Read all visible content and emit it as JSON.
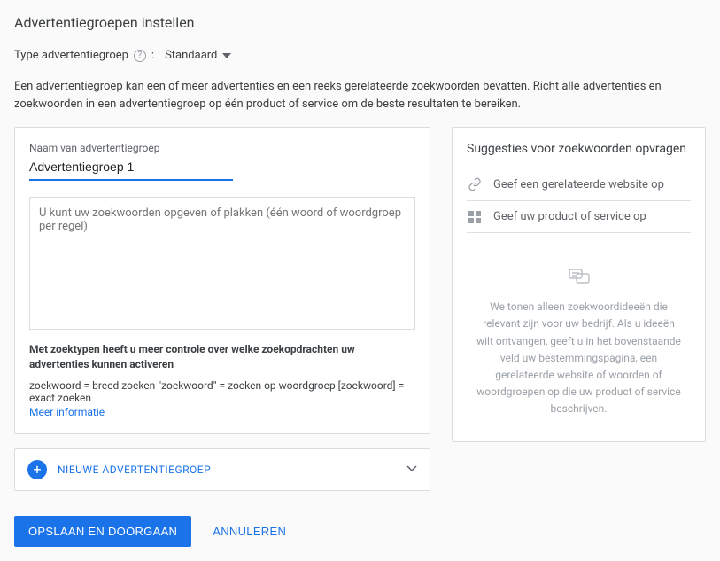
{
  "page_title": "Advertentiegroepen instellen",
  "type_row": {
    "label": "Type advertentiegroep",
    "colon": ":",
    "value": "Standaard"
  },
  "intro": "Een advertentiegroep kan een of meer advertenties en een reeks gerelateerde zoekwoorden bevatten. Richt alle advertenties en zoekwoorden in een advertentiegroep op één product of service om de beste resultaten te bereiken.",
  "ad_group": {
    "name_label": "Naam van advertentiegroep",
    "name_value": "Advertentiegroep 1",
    "keywords_placeholder": "U kunt uw zoekwoorden opgeven of plakken (één woord of woordgroep per regel)",
    "matchtype_note": "Met zoektypen heeft u meer controle over welke zoekopdrachten uw advertenties kunnen activeren",
    "matchtype_examples": "zoekwoord = breed zoeken   \"zoekwoord\" = zoeken op woordgroep   [zoekwoord] = exact zoeken",
    "more_info": "Meer informatie"
  },
  "new_group_label": "NIEUWE ADVERTENTIEGROEP",
  "suggestions": {
    "title": "Suggesties voor zoekwoorden opvragen",
    "website_row": "Geef een gerelateerde website op",
    "product_row": "Geef uw product of service op",
    "empty_text": "We tonen alleen zoekwoordideeën die relevant zijn voor uw bedrijf. Als u ideeën wilt ontvangen, geeft u in het bovenstaande veld uw bestemmingspagina, een gerelateerde website of woorden of woordgroepen op die uw product of service beschrijven."
  },
  "actions": {
    "save": "OPSLAAN EN DOORGAAN",
    "cancel": "ANNULEREN"
  }
}
